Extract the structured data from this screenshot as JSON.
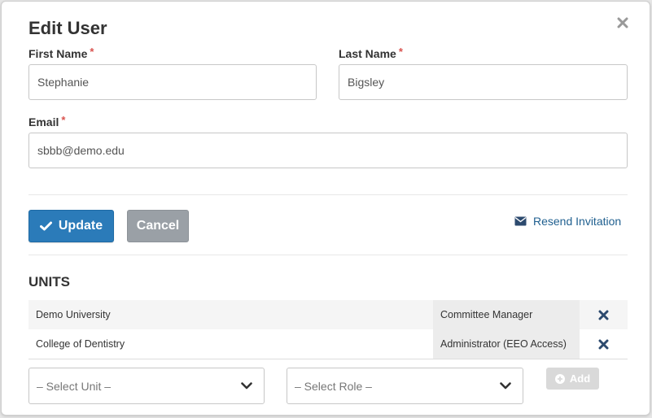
{
  "dialog": {
    "title": "Edit User"
  },
  "form": {
    "first_name": {
      "label": "First Name",
      "required_mark": "*",
      "value": "Stephanie"
    },
    "last_name": {
      "label": "Last Name",
      "required_mark": "*",
      "value": "Bigsley"
    },
    "email": {
      "label": "Email",
      "required_mark": "*",
      "value": "sbbb@demo.edu"
    }
  },
  "actions": {
    "update_label": "Update",
    "cancel_label": "Cancel",
    "resend_label": "Resend Invitation"
  },
  "units": {
    "title": "UNITS",
    "rows": [
      {
        "unit": "Demo University",
        "role": "Committee Manager"
      },
      {
        "unit": "College of Dentistry",
        "role": "Administrator (EEO Access)"
      }
    ],
    "select_unit_placeholder": "– Select Unit –",
    "select_role_placeholder": "– Select Role –",
    "add_label": "Add"
  },
  "icons": {
    "close": "close-icon",
    "check": "check-icon",
    "envelope": "envelope-icon",
    "delete": "delete-icon",
    "chevron": "chevron-down-icon",
    "plus": "plus-circle-icon"
  },
  "colors": {
    "primary": "#2b7bb9",
    "secondary": "#9aa0a6",
    "link": "#1f5f8f",
    "required": "#d9534f",
    "delete_icon": "#2c4a6e",
    "disabled": "#d9d9d9"
  }
}
